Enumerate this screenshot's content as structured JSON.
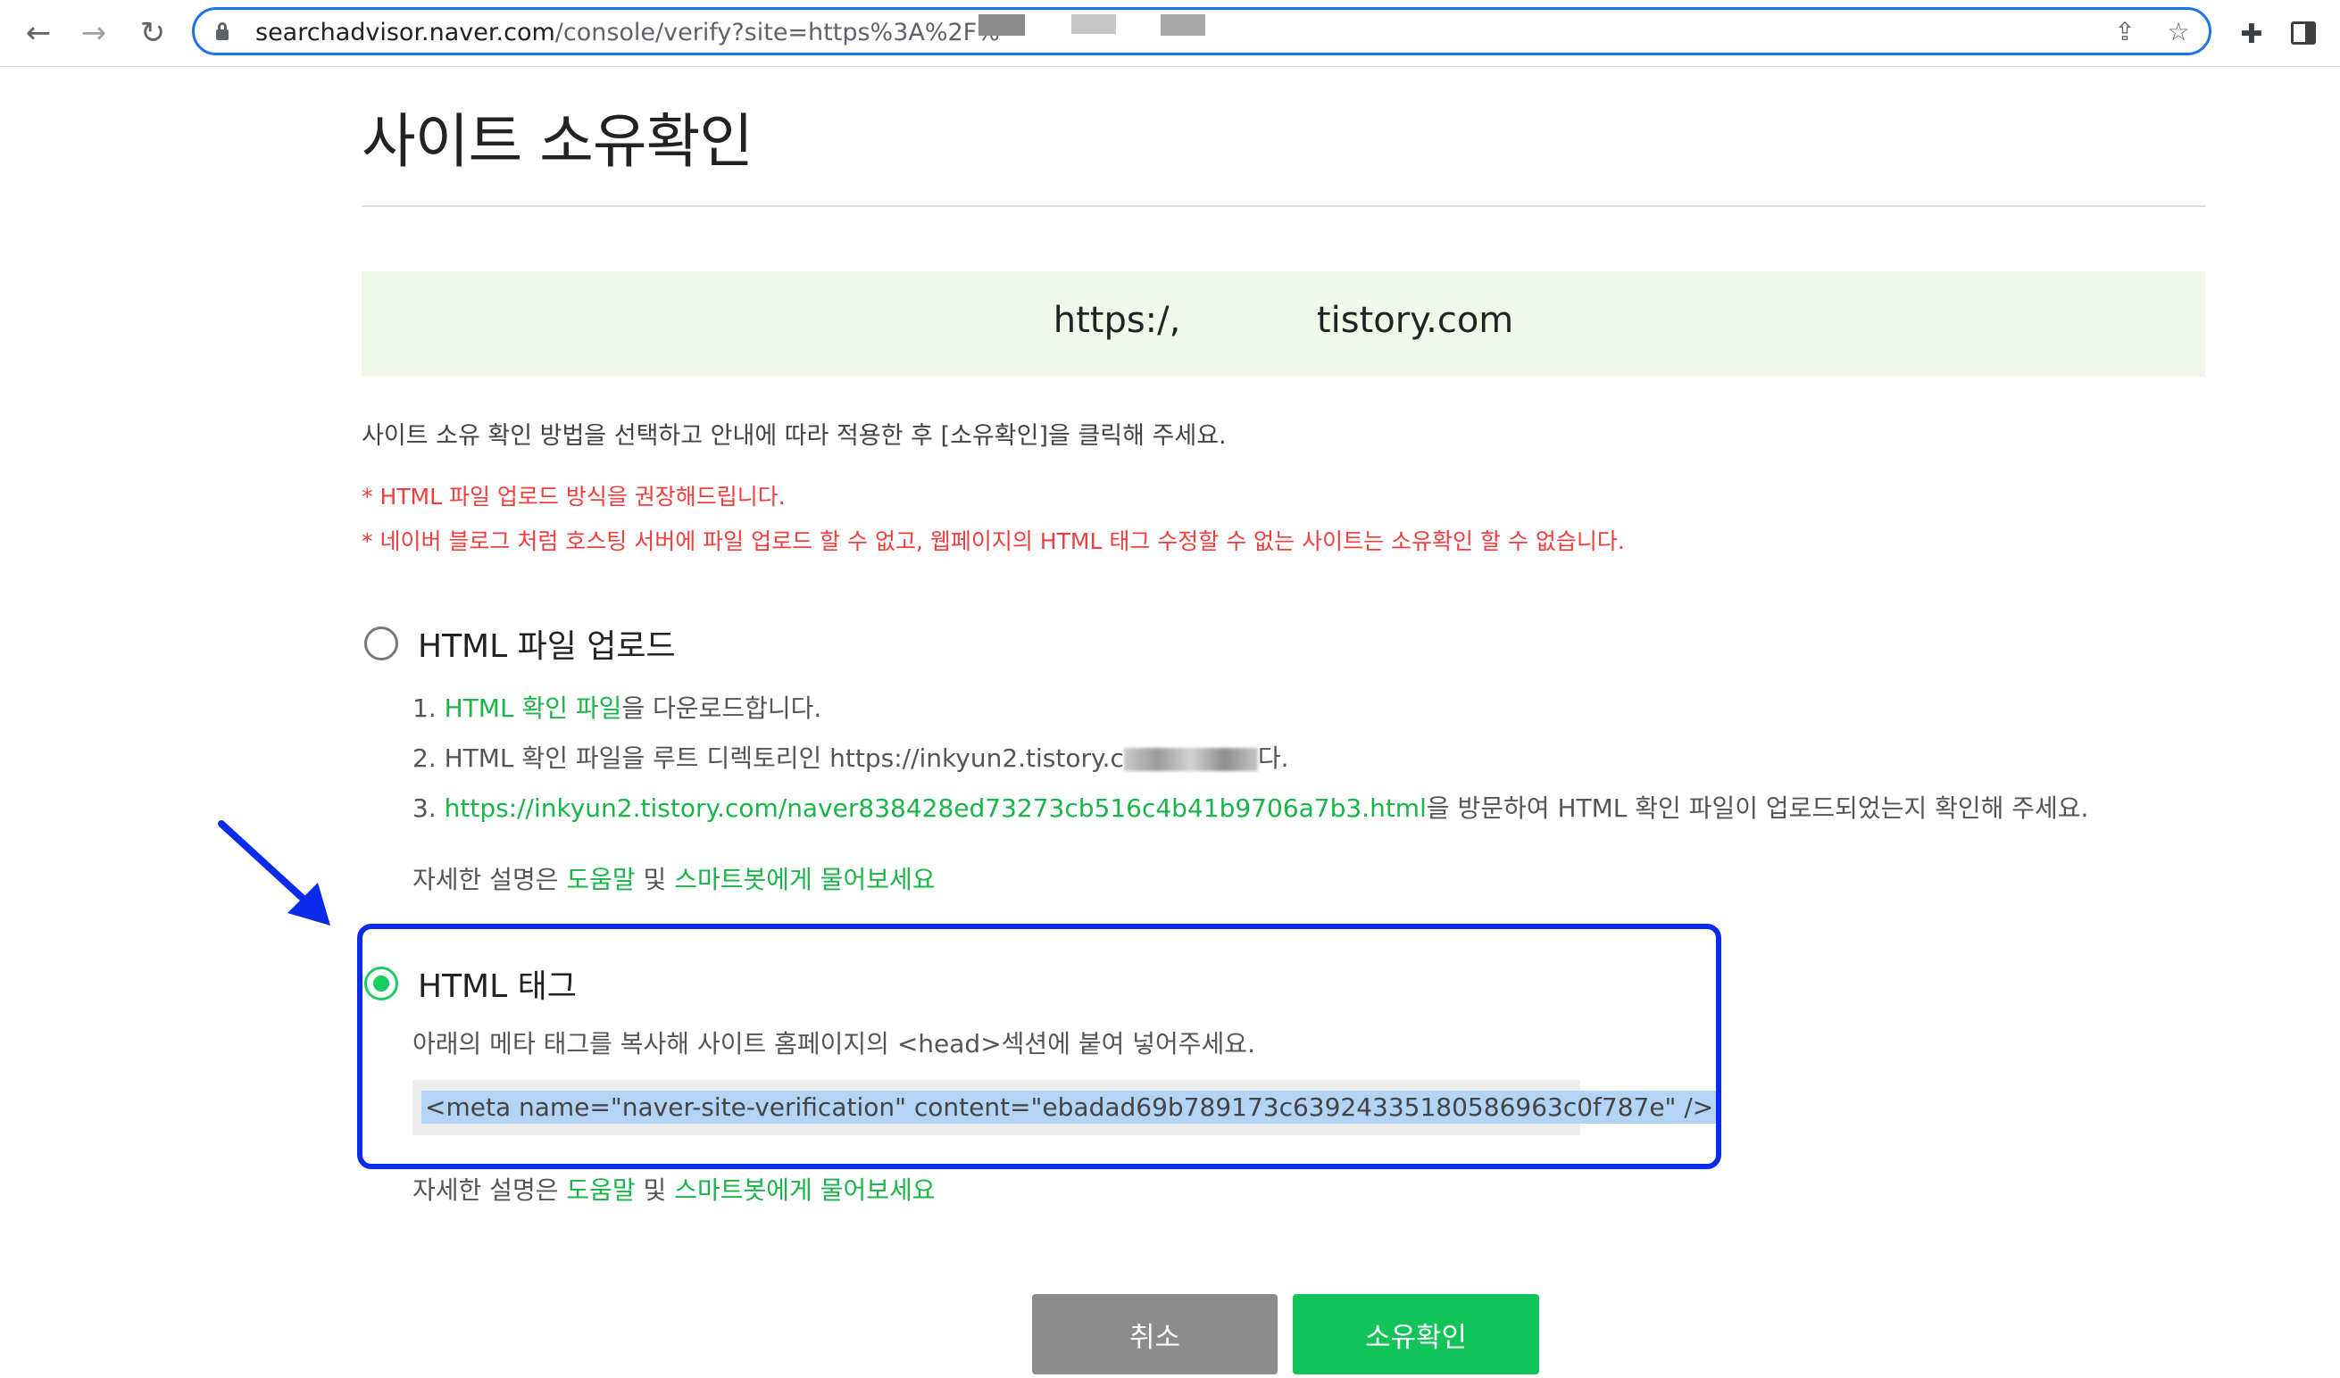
{
  "browser": {
    "back_icon": "←",
    "forward_icon": "→",
    "reload_icon": "↻",
    "url_host": "searchadvisor.naver.com",
    "url_path": "/console/verify?site=https%3A%2F%",
    "share_icon": "⇪",
    "star_icon": "☆",
    "extensions_icon": "✚"
  },
  "page": {
    "title": "사이트 소유확인",
    "site_url": "https:/,            tistory.com",
    "intro": "사이트 소유 확인 방법을 선택하고 안내에 따라 적용한 후 [소유확인]을 클릭해 주세요.",
    "warning_1": "* HTML 파일 업로드 방식을 권장해드립니다.",
    "warning_2": "* 네이버 블로그 처럼 호스팅 서버에 파일 업로드 할 수 없고, 웹페이지의 HTML 태그 수정할 수 없는 사이트는 소유확인 할 수 없습니다."
  },
  "option_file": {
    "label": "HTML 파일 업로드",
    "step1_prefix": "1. ",
    "step1_link": "HTML 확인 파일",
    "step1_suffix": "을 다운로드합니다.",
    "step2_prefix": "2. HTML 확인 파일을 루트 디렉토리인 https://inkyun2.tistory.c",
    "step2_suffix": "다.",
    "step3_prefix": "3. ",
    "step3_link": "https://inkyun2.tistory.com/naver838428ed73273cb516c4b41b9706a7b3.html",
    "step3_suffix": "을 방문하여 HTML 확인 파일이 업로드되었는지 확인해 주세요.",
    "help_prefix": "자세한 설명은 ",
    "help_link1": "도움말",
    "help_middle": " 및 ",
    "help_link2": "스마트봇에게 물어보세요"
  },
  "option_tag": {
    "label": "HTML 태그",
    "description": "아래의 메타 태그를 복사해 사이트 홈페이지의 <head>섹션에 붙여 넣어주세요.",
    "meta_tag": "<meta name=\"naver-site-verification\" content=\"ebadad69b789173c63924335180586963c0f787e\" />",
    "help_prefix": "자세한 설명은 ",
    "help_link1": "도움말",
    "help_middle": " 및 ",
    "help_link2": "스마트봇에게 물어보세요"
  },
  "buttons": {
    "cancel": "취소",
    "confirm": "소유확인"
  },
  "colors": {
    "accent_green": "#19ce60",
    "warning_red": "#f03e3e",
    "highlight_blue": "#0a2bea"
  }
}
